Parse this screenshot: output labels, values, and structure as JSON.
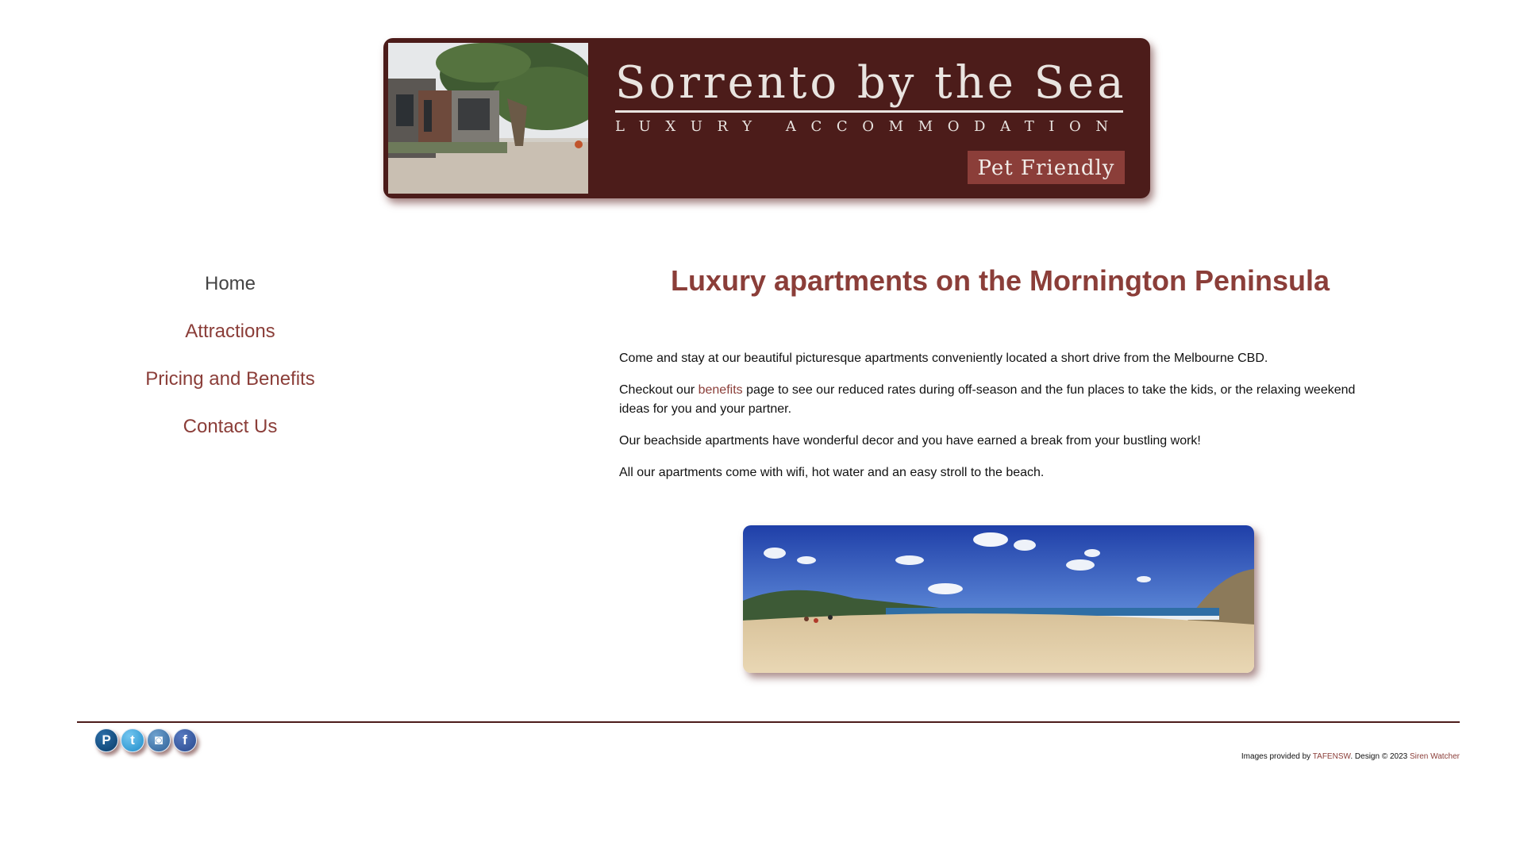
{
  "banner": {
    "title": "Sorrento by the Sea",
    "tagline": "LUXURY ACCOMMODATION",
    "badge": "Pet Friendly",
    "photo_alt": "house-among-trees"
  },
  "nav": {
    "items": [
      {
        "label": "Home",
        "active": true
      },
      {
        "label": "Attractions",
        "active": false
      },
      {
        "label": "Pricing and Benefits",
        "active": false
      },
      {
        "label": "Contact Us",
        "active": false
      }
    ]
  },
  "main": {
    "heading": "Luxury apartments on the Mornington Peninsula",
    "p1": "Come and stay at our beautiful picturesque apartments conveniently located a short drive from the Melbourne CBD.",
    "p2_before": "Checkout our ",
    "p2_link": "benefits",
    "p2_after": " page to see our reduced rates during off-season and the fun places to take the kids, or the relaxing weekend ideas for you and your partner.",
    "p3": "Our beachside apartments have wonderful decor and you have earned a break from your bustling work!",
    "p4": "All our apartments come with wifi, hot water and an easy stroll to the beach.",
    "image": "beach-panorama"
  },
  "footer": {
    "social_icons": [
      "pinterest-icon",
      "twitter-icon",
      "instagram-icon",
      "facebook-icon"
    ],
    "social_glyphs": {
      "pinterest": "P",
      "twitter": "t",
      "instagram": "◙",
      "facebook": "f"
    },
    "credits_prefix": "Images provided by ",
    "credits_link1": "TAFENSW",
    "credits_middle": ". Design © 2023 ",
    "credits_link2": "Siren Watcher"
  },
  "colors": {
    "brand": "#4c1c1a",
    "accent": "#8b3e39",
    "text": "#111111"
  }
}
